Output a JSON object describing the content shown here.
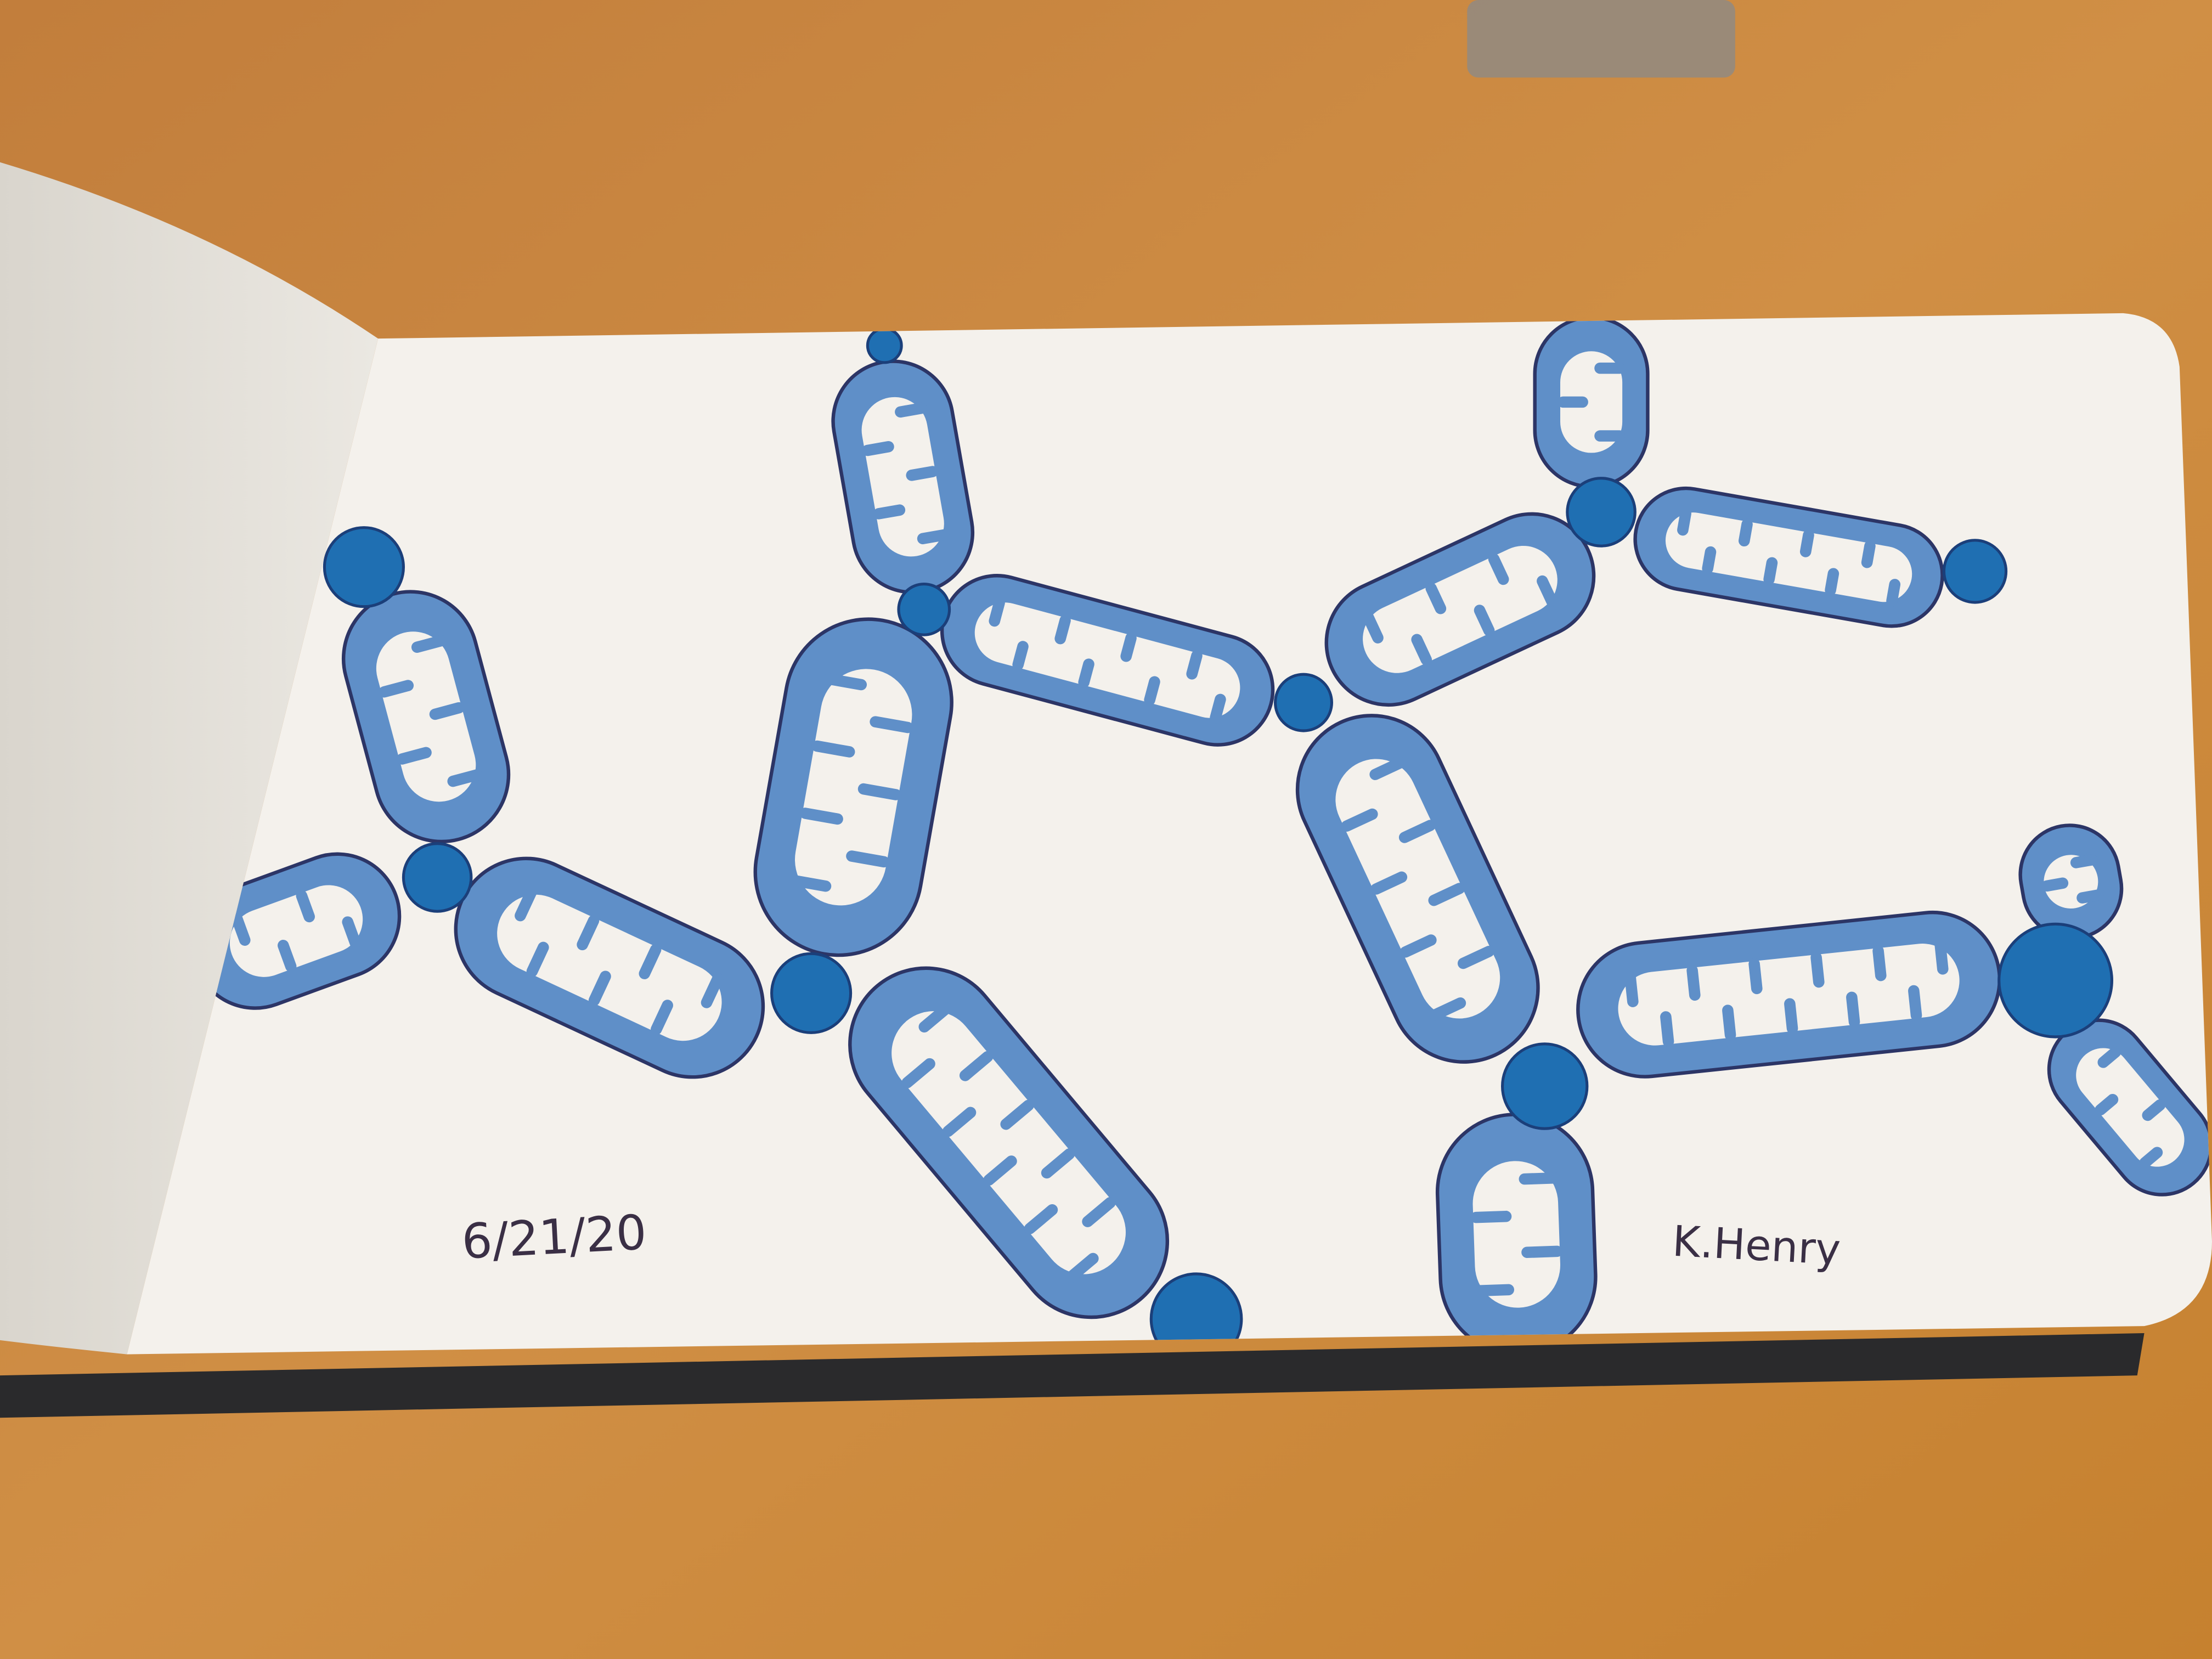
{
  "drawing": {
    "date": "6/21/20",
    "signature": "K.Henry"
  },
  "colors": {
    "desk": "#c98a3e",
    "page": "#f4f1ec",
    "mito_fill": "#5f8fc8",
    "mito_outline": "#2c3566",
    "dot": "#1f6fb2",
    "binding": "#2a2a2c"
  }
}
